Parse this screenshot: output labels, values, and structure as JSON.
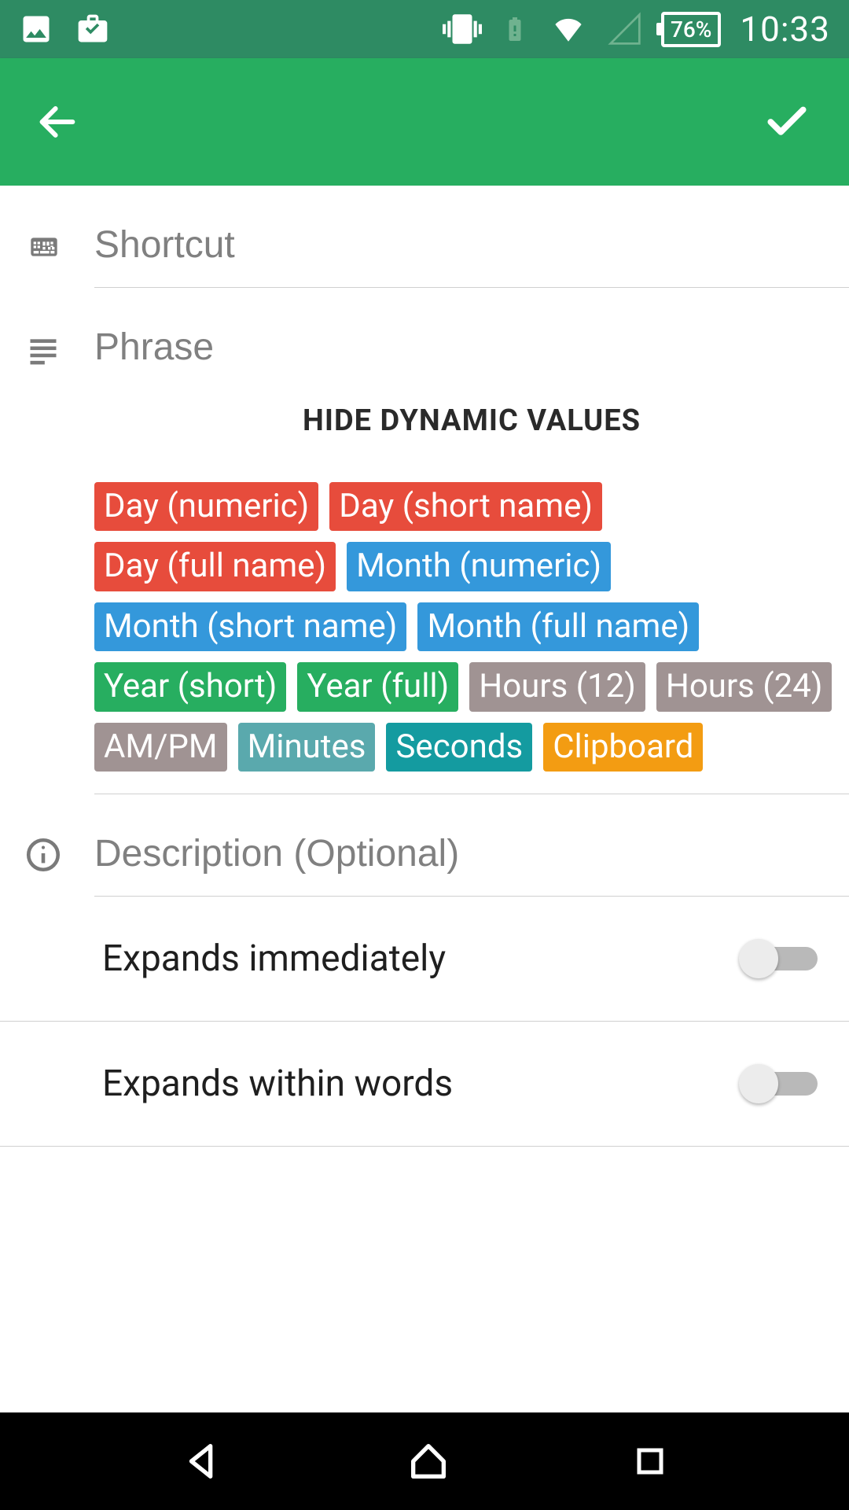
{
  "status": {
    "battery_text": "76%",
    "clock": "10:33"
  },
  "fields": {
    "shortcut_placeholder": "Shortcut",
    "phrase_placeholder": "Phrase",
    "description_placeholder": "Description (Optional)"
  },
  "dynamic_header": "HIDE DYNAMIC VALUES",
  "chips": [
    {
      "label": "Day (numeric)",
      "cls": "chip-red"
    },
    {
      "label": "Day (short name)",
      "cls": "chip-red"
    },
    {
      "label": "Day (full name)",
      "cls": "chip-red"
    },
    {
      "label": "Month (numeric)",
      "cls": "chip-blue"
    },
    {
      "label": "Month (short name)",
      "cls": "chip-blue"
    },
    {
      "label": "Month (full name)",
      "cls": "chip-blue"
    },
    {
      "label": "Year (short)",
      "cls": "chip-green"
    },
    {
      "label": "Year (full)",
      "cls": "chip-green"
    },
    {
      "label": "Hours (12)",
      "cls": "chip-gray"
    },
    {
      "label": "Hours (24)",
      "cls": "chip-gray"
    },
    {
      "label": "AM/PM",
      "cls": "chip-gray"
    },
    {
      "label": "Minutes",
      "cls": "chip-teal"
    },
    {
      "label": "Seconds",
      "cls": "chip-tealdark"
    },
    {
      "label": "Clipboard",
      "cls": "chip-orange"
    }
  ],
  "switches": {
    "expands_immediately": "Expands immediately",
    "expands_within_words": "Expands within words"
  }
}
